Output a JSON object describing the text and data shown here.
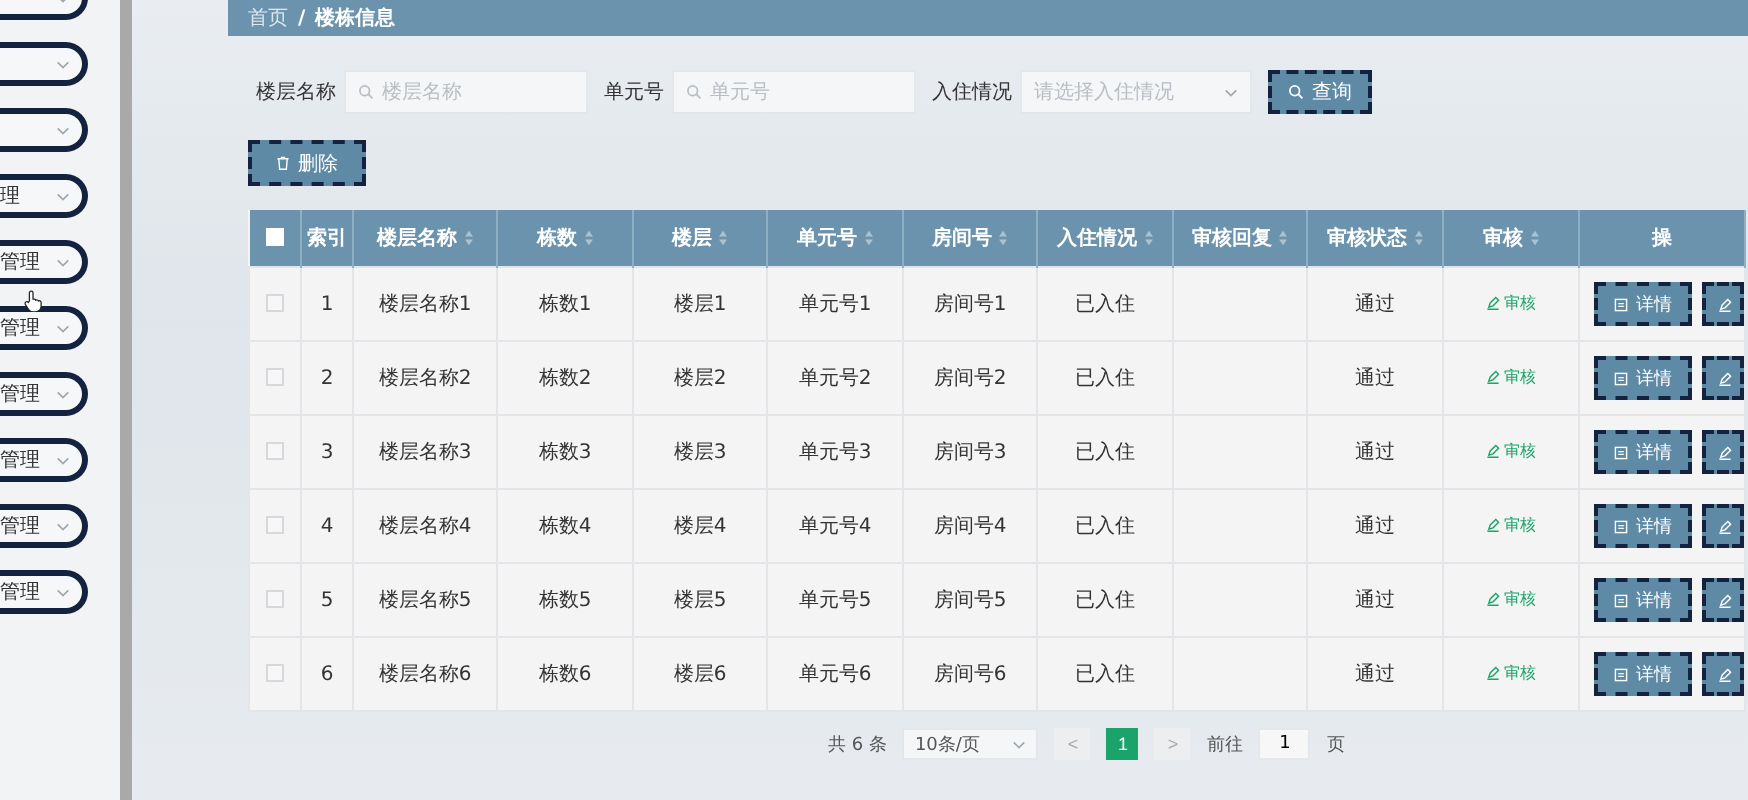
{
  "sidebar": {
    "items": [
      {
        "kind": "blank"
      },
      {
        "kind": "blank"
      },
      {
        "kind": "blank"
      },
      {
        "kind": "labeled",
        "label": "理"
      },
      {
        "kind": "labeled",
        "label": "管理"
      },
      {
        "kind": "labeled",
        "label": "管理"
      },
      {
        "kind": "labeled",
        "label": "管理"
      },
      {
        "kind": "labeled",
        "label": "管理"
      },
      {
        "kind": "labeled",
        "label": "管理"
      },
      {
        "kind": "labeled",
        "label": "管理"
      }
    ]
  },
  "breadcrumb": {
    "home": "首页",
    "separator": "/",
    "current": "楼栋信息"
  },
  "search": {
    "fields": [
      {
        "kind": "input",
        "label": "楼层名称",
        "placeholder": "楼层名称"
      },
      {
        "kind": "input",
        "label": "单元号",
        "placeholder": "单元号"
      },
      {
        "kind": "select",
        "label": "入住情况",
        "placeholder": "请选择入住情况"
      }
    ],
    "button": "查询"
  },
  "delete_button": "删除",
  "table": {
    "select_all": {
      "checked": false
    },
    "columns": [
      {
        "label": "索引",
        "sortable": false
      },
      {
        "label": "楼层名称",
        "sortable": true
      },
      {
        "label": "栋数",
        "sortable": true
      },
      {
        "label": "楼层",
        "sortable": true
      },
      {
        "label": "单元号",
        "sortable": true
      },
      {
        "label": "房间号",
        "sortable": true
      },
      {
        "label": "入住情况",
        "sortable": true
      },
      {
        "label": "审核回复",
        "sortable": true
      },
      {
        "label": "审核状态",
        "sortable": true
      },
      {
        "label": "审核",
        "sortable": true
      },
      {
        "label": "操",
        "sortable": false
      }
    ],
    "rows": [
      {
        "checked": false,
        "cells": [
          "1",
          "楼层名称1",
          "栋数1",
          "楼层1",
          "单元号1",
          "房间号1",
          "已入住",
          "",
          "通过"
        ],
        "review_link": "审核",
        "detail_button": "详情"
      },
      {
        "checked": false,
        "cells": [
          "2",
          "楼层名称2",
          "栋数2",
          "楼层2",
          "单元号2",
          "房间号2",
          "已入住",
          "",
          "通过"
        ],
        "review_link": "审核",
        "detail_button": "详情"
      },
      {
        "checked": false,
        "cells": [
          "3",
          "楼层名称3",
          "栋数3",
          "楼层3",
          "单元号3",
          "房间号3",
          "已入住",
          "",
          "通过"
        ],
        "review_link": "审核",
        "detail_button": "详情"
      },
      {
        "checked": false,
        "cells": [
          "4",
          "楼层名称4",
          "栋数4",
          "楼层4",
          "单元号4",
          "房间号4",
          "已入住",
          "",
          "通过"
        ],
        "review_link": "审核",
        "detail_button": "详情"
      },
      {
        "checked": false,
        "cells": [
          "5",
          "楼层名称5",
          "栋数5",
          "楼层5",
          "单元号5",
          "房间号5",
          "已入住",
          "",
          "通过"
        ],
        "review_link": "审核",
        "detail_button": "详情"
      },
      {
        "checked": false,
        "cells": [
          "6",
          "楼层名称6",
          "栋数6",
          "楼层6",
          "单元号6",
          "房间号6",
          "已入住",
          "",
          "通过"
        ],
        "review_link": "审核",
        "detail_button": "详情"
      }
    ]
  },
  "pagination": {
    "total": "共 6 条",
    "page_size": "10条/页",
    "prev": "<",
    "pages": [
      {
        "label": "1",
        "selected": true
      }
    ],
    "next": ">",
    "goto_label": "前往",
    "goto_value": "1",
    "goto_suffix": "页"
  }
}
